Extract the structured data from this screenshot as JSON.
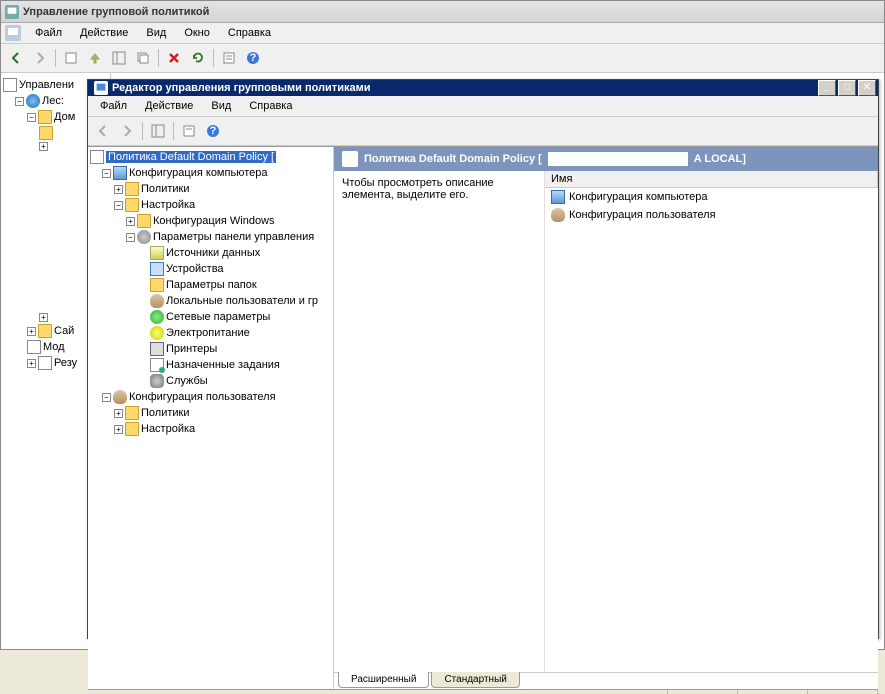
{
  "outer": {
    "title": "Управление групповой политикой",
    "menu": {
      "file": "Файл",
      "action": "Действие",
      "view": "Вид",
      "window": "Окно",
      "help": "Справка"
    }
  },
  "outer_tree": {
    "root": "Управлени",
    "forest": "Лес:",
    "domain": "Дом",
    "sites": "Сай",
    "modeling": "Мод",
    "results": "Резу"
  },
  "inner": {
    "title": "Редактор управления групповыми политиками",
    "menu": {
      "file": "Файл",
      "action": "Действие",
      "view": "Вид",
      "help": "Справка"
    }
  },
  "tree": {
    "root": "Политика Default Domain Policy [",
    "computer_cfg": "Конфигурация компьютера",
    "policies": "Политики",
    "settings": "Настройка",
    "win_cfg": "Конфигурация Windows",
    "cp_params": "Параметры панели управления",
    "items": {
      "data_sources": "Источники данных",
      "devices": "Устройства",
      "folder_options": "Параметры папок",
      "local_users": "Локальные пользователи и гр",
      "network_params": "Сетевые параметры",
      "power": "Электропитание",
      "printers": "Принтеры",
      "scheduled": "Назначенные задания",
      "services": "Службы"
    },
    "user_cfg": "Конфигурация пользователя",
    "user_policies": "Политики",
    "user_settings": "Настройка"
  },
  "right": {
    "header": "Политика Default Domain Policy [",
    "header_tail": "A LOCAL]",
    "desc": "Чтобы просмотреть описание элемента, выделите его.",
    "col_name": "Имя",
    "item_comp": "Конфигурация компьютера",
    "item_user": "Конфигурация пользователя"
  },
  "tabs": {
    "extended": "Расширенный",
    "standard": "Стандартный"
  }
}
